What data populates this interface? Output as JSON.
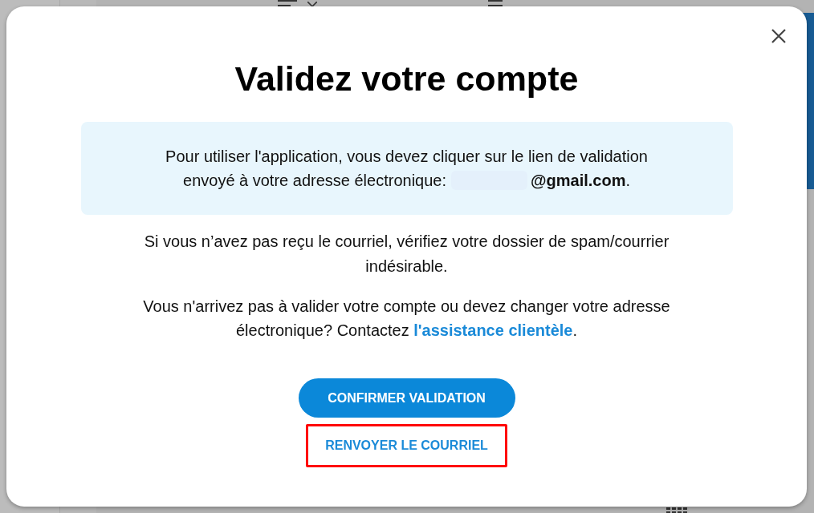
{
  "dialog": {
    "title": "Validez votre compte",
    "info": {
      "line_1": "Pour utiliser l'application, vous devez cliquer sur le lien de validation",
      "line_2": "envoyé à votre adresse électronique:",
      "email_suffix": "**@gmail.com**."
    },
    "spam_note": "Si vous n’avez pas reçu le courriel, vérifiez votre dossier de spam/courrier indésirable.",
    "help": {
      "text": "Vous n'arrivez pas à valider votre compte ou devez changer votre adresse électronique? Contactez",
      "link": "l'assistance clientèle",
      "after": "."
    },
    "confirm_button": "CONFIRMER VALIDATION",
    "resend_button": {
      "label": "RENVOYER LE COURRIEL",
      "highlighted": true
    }
  }
}
